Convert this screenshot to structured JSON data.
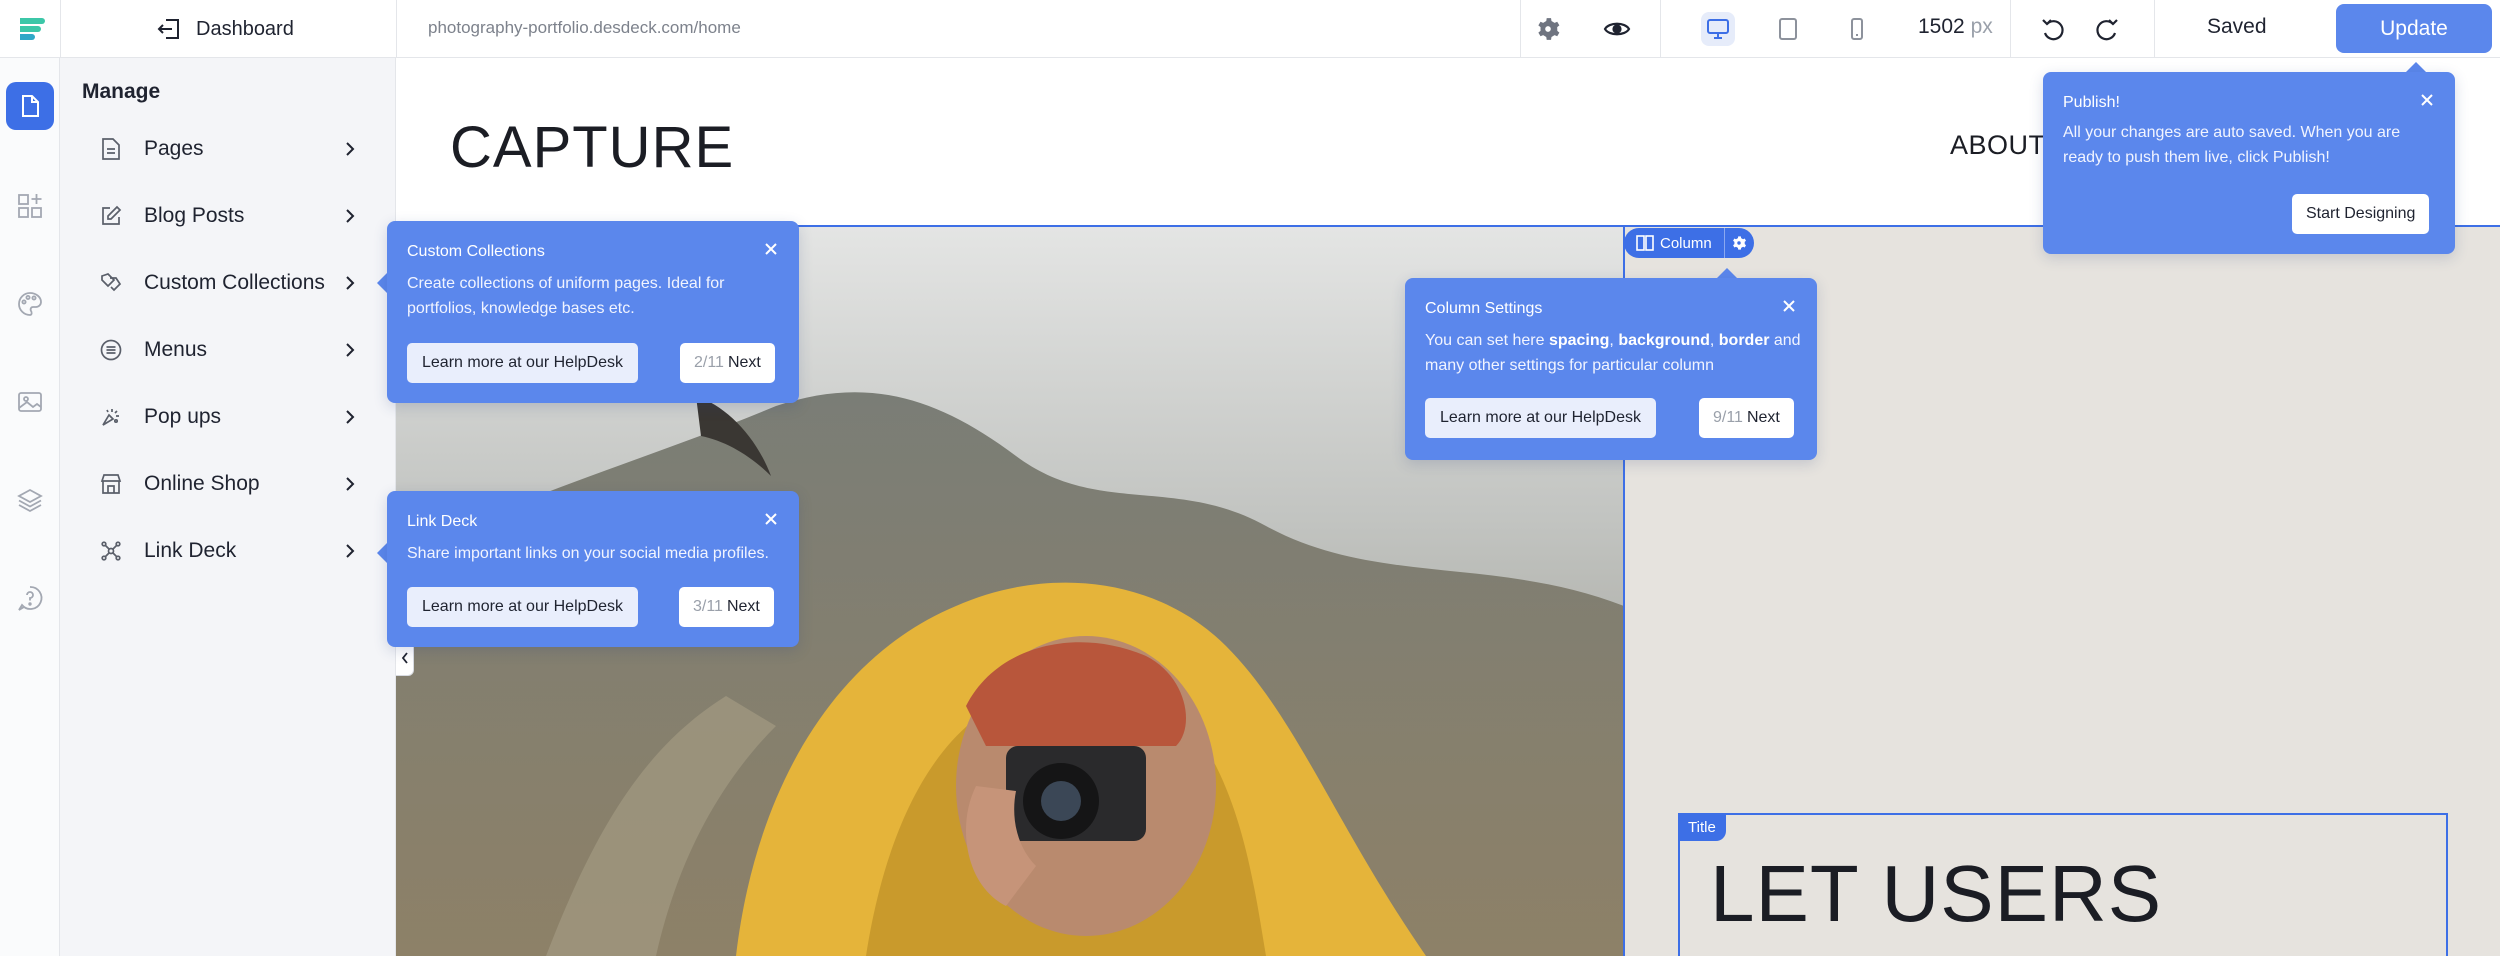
{
  "topbar": {
    "dashboard_label": "Dashboard",
    "url": "photography-portfolio.desdeck.com/home",
    "width_value": "1502",
    "width_unit": "px",
    "saved_label": "Saved",
    "update_label": "Update"
  },
  "manage": {
    "title": "Manage",
    "items": [
      {
        "label": "Pages",
        "icon": "page-icon"
      },
      {
        "label": "Blog Posts",
        "icon": "edit-icon"
      },
      {
        "label": "Custom Collections",
        "icon": "collections-icon"
      },
      {
        "label": "Menus",
        "icon": "menu-icon"
      },
      {
        "label": "Pop ups",
        "icon": "popup-icon"
      },
      {
        "label": "Online Shop",
        "icon": "shop-icon"
      },
      {
        "label": "Link Deck",
        "icon": "link-deck-icon"
      }
    ]
  },
  "site": {
    "logo": "CAPTURE",
    "nav_about": "ABOUT",
    "hero_title": "LET USERS",
    "column_badge": "Column",
    "title_tag": "Title"
  },
  "tips": {
    "collections": {
      "title": "Custom Collections",
      "body": "Create collections of uniform pages. Ideal for portfolios, knowledge bases etc.",
      "help": "Learn more at our HelpDesk",
      "count": "2/11",
      "next": "Next"
    },
    "linkdeck": {
      "title": "Link Deck",
      "body": "Share important links on your social media profiles.",
      "help": "Learn more at our HelpDesk",
      "count": "3/11",
      "next": "Next"
    },
    "column": {
      "title": "Column Settings",
      "body_pre": "You can set here ",
      "body_b1": "spacing",
      "body_sep1": ", ",
      "body_b2": "background",
      "body_sep2": ", ",
      "body_b3": "border",
      "body_post": " and many other settings for particular column",
      "help": "Learn more at our HelpDesk",
      "count": "9/11",
      "next": "Next"
    },
    "publish": {
      "title": "Publish!",
      "body": "All your changes are auto saved. When you are ready to push them live, click Publish!",
      "button": "Start Designing"
    }
  },
  "colors": {
    "accent": "#3d6fe6",
    "tooltip": "#5b87ec",
    "brand_teal": "#3cc7a8"
  }
}
